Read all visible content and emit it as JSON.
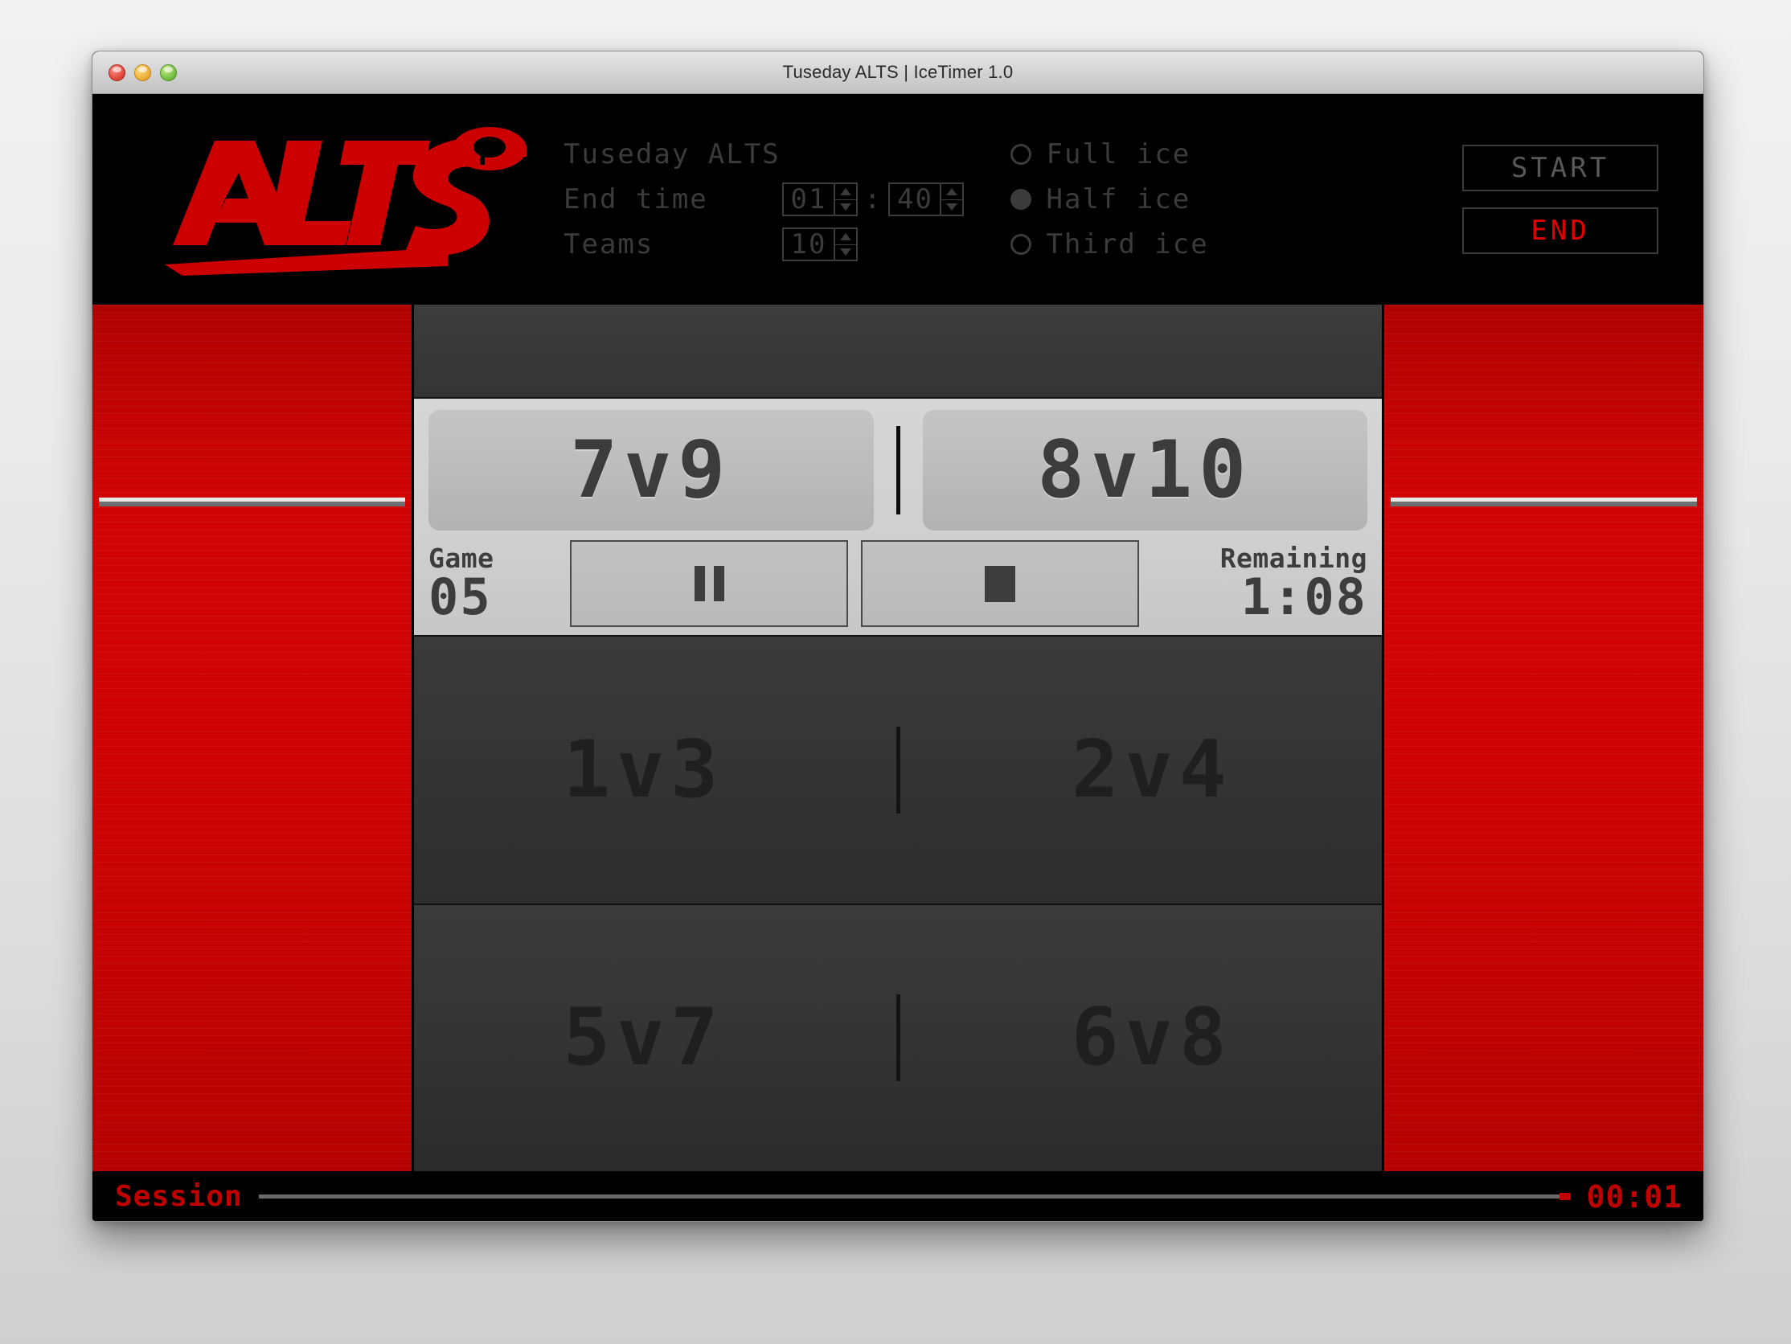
{
  "window": {
    "title": "Tuseday ALTS | IceTimer 1.0",
    "traffic_lights": [
      "close-button",
      "minimize-button",
      "zoom-button"
    ]
  },
  "header": {
    "logo_text": "ALTS",
    "session_name": "Tuseday ALTS",
    "end_time_label": "End time",
    "end_time_hours": "01",
    "end_time_minutes": "40",
    "time_separator": ":",
    "teams_label": "Teams",
    "teams_value": "10",
    "ice_options": [
      {
        "label": "Full ice",
        "selected": false
      },
      {
        "label": "Half ice",
        "selected": true
      },
      {
        "label": "Third ice",
        "selected": false
      }
    ],
    "start_label": "START",
    "end_label": "END",
    "colors": {
      "brand_red": "#cc0000",
      "end_red": "#e00000",
      "dim_text": "#3b3b3b",
      "start_text": "#585858"
    }
  },
  "schedule": {
    "active": {
      "left_match": "7v9",
      "right_match": "8v10"
    },
    "controls": {
      "game_caption": "Game",
      "game_number": "05",
      "pause_icon": "pause-icon",
      "stop_icon": "stop-icon",
      "remaining_caption": "Remaining",
      "remaining_time": "1:08"
    },
    "upcoming": [
      {
        "left_match": "1v3",
        "right_match": "2v4"
      },
      {
        "left_match": "5v7",
        "right_match": "6v8"
      }
    ]
  },
  "session": {
    "label": "Session",
    "elapsed": "00:01"
  }
}
